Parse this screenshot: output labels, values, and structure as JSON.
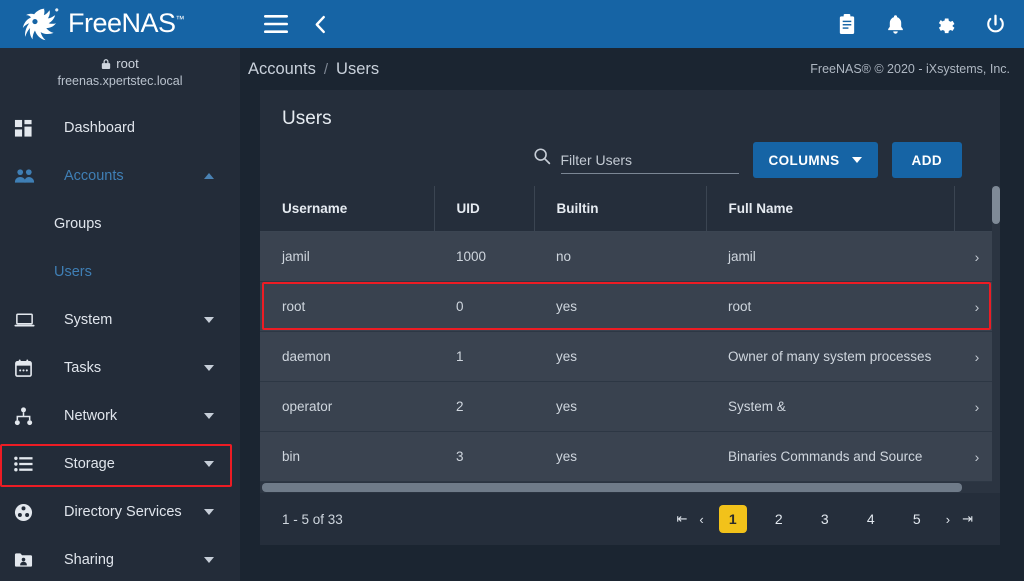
{
  "brand": {
    "name": "FreeNAS",
    "trademark": "™",
    "logo_icon": "freenas-shark-logo",
    "header_color": "#1664a5"
  },
  "sidebar": {
    "user": {
      "lock_icon": "lock-icon",
      "username": "root",
      "hostname": "freenas.xpertstec.local"
    },
    "items": [
      {
        "label": "Dashboard",
        "icon": "dashboard-grid-icon",
        "expandable": false,
        "active": false
      },
      {
        "label": "Accounts",
        "icon": "users-group-icon",
        "expandable": true,
        "expanded": true,
        "active": true
      },
      {
        "label": "System",
        "icon": "laptop-icon",
        "expandable": true,
        "expanded": false,
        "active": false
      },
      {
        "label": "Tasks",
        "icon": "calendar-icon",
        "expandable": true,
        "expanded": false,
        "active": false
      },
      {
        "label": "Network",
        "icon": "sitemap-icon",
        "expandable": true,
        "expanded": false,
        "active": false
      },
      {
        "label": "Storage",
        "icon": "storage-list-icon",
        "expandable": true,
        "expanded": false,
        "active": false,
        "highlighted": true
      },
      {
        "label": "Directory Services",
        "icon": "directory-circle-icon",
        "expandable": true,
        "expanded": false,
        "active": false
      },
      {
        "label": "Sharing",
        "icon": "folder-share-icon",
        "expandable": true,
        "expanded": false,
        "active": false
      }
    ],
    "accounts_children": [
      {
        "label": "Groups",
        "active": false
      },
      {
        "label": "Users",
        "active": true
      }
    ]
  },
  "topbar": {
    "menu_icon": "hamburger-menu-icon",
    "back_icon": "chevron-left-icon",
    "right_icons": [
      {
        "name": "clipboard-icon"
      },
      {
        "name": "bell-notification-icon"
      },
      {
        "name": "gear-settings-icon"
      },
      {
        "name": "power-icon"
      }
    ]
  },
  "breadcrumb": {
    "parent": "Accounts",
    "separator": "/",
    "current": "Users"
  },
  "copyright": "FreeNAS® © 2020 - iXsystems, Inc.",
  "card": {
    "title": "Users",
    "search": {
      "icon": "search-icon",
      "placeholder": "Filter Users",
      "value": ""
    },
    "columns_button": "COLUMNS",
    "add_button": "ADD"
  },
  "table": {
    "headers": [
      "Username",
      "UID",
      "Builtin",
      "Full Name"
    ],
    "row_chevron_icon": "chevron-right-icon",
    "rows": [
      {
        "username": "jamil",
        "uid": "1000",
        "builtin": "no",
        "fullname": "jamil",
        "highlighted": true
      },
      {
        "username": "root",
        "uid": "0",
        "builtin": "yes",
        "fullname": "root",
        "highlighted": false
      },
      {
        "username": "daemon",
        "uid": "1",
        "builtin": "yes",
        "fullname": "Owner of many system processes",
        "highlighted": false
      },
      {
        "username": "operator",
        "uid": "2",
        "builtin": "yes",
        "fullname": "System &",
        "highlighted": false
      },
      {
        "username": "bin",
        "uid": "3",
        "builtin": "yes",
        "fullname": "Binaries Commands and Source",
        "highlighted": false
      }
    ]
  },
  "pagination": {
    "range_text": "1 - 5 of 33",
    "first_icon": "first-page-icon",
    "prev_icon": "prev-page-icon",
    "next_icon": "next-page-icon",
    "last_icon": "last-page-icon",
    "pages": [
      "1",
      "2",
      "3",
      "4",
      "5"
    ],
    "active_page": "1",
    "active_color": "#f2c21a"
  },
  "annotations": {
    "highlight_color": "#ed1c24",
    "boxes": [
      "storage-sidebar-item",
      "jamil-table-row"
    ]
  }
}
